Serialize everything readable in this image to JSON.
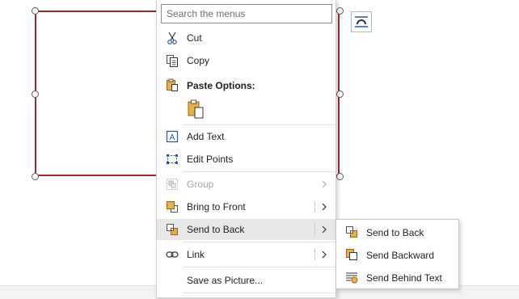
{
  "menu": {
    "search_placeholder": "Search the menus",
    "cut": "Cut",
    "copy": "Copy",
    "paste_options": "Paste Options:",
    "add_text": "Add Text",
    "edit_points": "Edit Points",
    "group": "Group",
    "bring_to_front": "Bring to Front",
    "send_to_back": "Send to Back",
    "link": "Link",
    "save_as_picture": "Save as Picture..."
  },
  "submenu": {
    "send_to_back": "Send to Back",
    "send_backward": "Send Backward",
    "send_behind_text": "Send Behind Text"
  },
  "colors": {
    "shape_outline": "#a4262c",
    "icon_blue": "#2b579a",
    "icon_orange": "#d48a1a",
    "hover_bg": "#e8e8e8"
  },
  "icons": [
    "scissors-icon",
    "copy-icon",
    "clipboard-icon",
    "paste-keep-source-icon",
    "text-box-icon",
    "edit-points-icon",
    "group-icon",
    "bring-to-front-icon",
    "send-to-back-icon",
    "link-icon",
    "send-backward-icon",
    "send-behind-text-icon",
    "layout-options-icon",
    "chevron-right-icon"
  ]
}
